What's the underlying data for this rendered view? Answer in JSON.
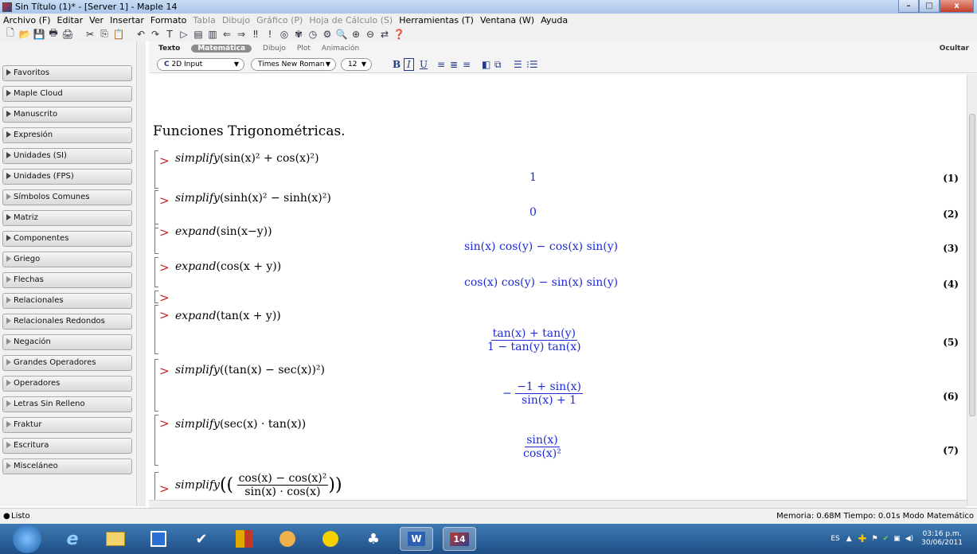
{
  "window": {
    "title": "Sin Título (1)* - [Server 1] - Maple 14",
    "minimize": "–",
    "maximize": "□",
    "close": "x"
  },
  "menu": [
    {
      "label": "Archivo (F)",
      "enabled": true
    },
    {
      "label": "Editar",
      "enabled": true
    },
    {
      "label": "Ver",
      "enabled": true
    },
    {
      "label": "Insertar",
      "enabled": true
    },
    {
      "label": "Formato",
      "enabled": true
    },
    {
      "label": "Tabla",
      "enabled": false
    },
    {
      "label": "Dibujo",
      "enabled": false
    },
    {
      "label": "Gráfico (P)",
      "enabled": false
    },
    {
      "label": "Hoja de Cálculo (S)",
      "enabled": false
    },
    {
      "label": "Herramientas (T)",
      "enabled": true
    },
    {
      "label": "Ventana (W)",
      "enabled": true
    },
    {
      "label": "Ayuda",
      "enabled": true
    }
  ],
  "toolbar_icons": [
    "new-icon",
    "open-icon",
    "save-icon",
    "print-icon",
    "print-preview-icon",
    "cut-icon",
    "copy-icon",
    "paste-icon",
    "undo-icon",
    "redo-icon",
    "text-mode-icon",
    "execute-group-icon",
    "insert-section-icon",
    "outdent-icon",
    "back-icon",
    "forward-icon",
    "execute-all-icon",
    "execute-icon",
    "stop-icon",
    "restart-icon",
    "debug-icon",
    "settings-icon",
    "zoom-100-icon",
    "zoom-in-icon",
    "zoom-out-icon",
    "show-hidden-icon",
    "help-icon"
  ],
  "toolbar_glyphs": [
    "🗋",
    "📂",
    "💾",
    "🖶",
    "🖨",
    "✂",
    "⎘",
    "📋",
    "↶",
    "↷",
    "T",
    "▷",
    "▤",
    "▥",
    "⇐",
    "⇒",
    "‼",
    "!",
    "◎",
    "✾",
    "◷",
    "⚙",
    "🔍",
    "⊕",
    "⊖",
    "⇄",
    "❓"
  ],
  "sidebar": {
    "palettes": [
      {
        "label": "Favoritos",
        "state": "collapsed"
      },
      {
        "label": "Maple Cloud",
        "state": "collapsed"
      },
      {
        "label": "Manuscrito",
        "state": "collapsed"
      },
      {
        "label": "Expresión",
        "state": "collapsed"
      },
      {
        "label": "Unidades (SI)",
        "state": "collapsed"
      },
      {
        "label": "Unidades (FPS)",
        "state": "collapsed"
      },
      {
        "label": "Símbolos Comunes",
        "state": "empty"
      },
      {
        "label": "Matriz",
        "state": "collapsed"
      },
      {
        "label": "Componentes",
        "state": "collapsed"
      },
      {
        "label": "Griego",
        "state": "empty"
      },
      {
        "label": "Flechas",
        "state": "empty"
      },
      {
        "label": "Relacionales",
        "state": "empty"
      },
      {
        "label": "Relacionales Redondos",
        "state": "empty"
      },
      {
        "label": "Negación",
        "state": "empty"
      },
      {
        "label": "Grandes Operadores",
        "state": "empty"
      },
      {
        "label": "Operadores",
        "state": "empty"
      },
      {
        "label": "Letras Sin Relleno",
        "state": "empty"
      },
      {
        "label": "Fraktur",
        "state": "empty"
      },
      {
        "label": "Escritura",
        "state": "empty"
      },
      {
        "label": "Misceláneo",
        "state": "empty"
      }
    ]
  },
  "context": {
    "tabs": [
      {
        "label": "Texto",
        "active": false
      },
      {
        "label": "Matemática",
        "active": true
      },
      {
        "label": "Dibujo",
        "active": false
      },
      {
        "label": "Plot",
        "active": false
      },
      {
        "label": "Animación",
        "active": false
      }
    ],
    "hide_label": "Ocultar",
    "input_mode": "2D Input",
    "input_mode_icon": "C",
    "font": "Times New Roman",
    "size": "12",
    "format_buttons": [
      "B",
      "I",
      "U"
    ],
    "align_glyphs": [
      "≡",
      "≣",
      "≡",
      "◧",
      "⧉",
      "☰",
      "⁝☰"
    ]
  },
  "document": {
    "title": "Funciones Trigonométricas.",
    "prompt": ">",
    "commands": [
      {
        "cmd": "simplify",
        "arg": "sin(x)² + cos(x)²",
        "output": "1",
        "label": "(1)"
      },
      {
        "cmd": "simplify",
        "arg": "sinh(x)² − sinh(x)²",
        "output": "0",
        "label": "(2)"
      },
      {
        "cmd": "expand",
        "arg": "sin(x−y)",
        "output": "sin(x) cos(y) − cos(x) sin(y)",
        "label": "(3)"
      },
      {
        "cmd": "expand",
        "arg": "cos(x + y)",
        "output": "cos(x) cos(y) − sin(x) sin(y)",
        "label": "(4)"
      },
      {
        "cmd": "expand",
        "arg": "tan(x + y)",
        "output_num": "tan(x) + tan(y)",
        "output_den": "1 − tan(y) tan(x)",
        "label": "(5)"
      },
      {
        "cmd": "simplify",
        "arg": "(tan(x) − sec(x))²",
        "output_sign": "−",
        "output_num": "−1 + sin(x)",
        "output_den": "sin(x) + 1",
        "label": "(6)"
      },
      {
        "cmd": "simplify",
        "arg": "sec(x) · tan(x)",
        "output_num": "sin(x)",
        "output_den": "cos(x)²",
        "label": "(7)"
      },
      {
        "cmd": "simplify",
        "arg_num": "cos(x) − cos(x)²",
        "arg_den": "sin(x) · cos(x)"
      }
    ]
  },
  "status": {
    "left": "Listo",
    "right": "Memoria: 0.68M  Tiempo: 0.01s  Modo Matemático"
  },
  "taskbar": {
    "lang": "ES",
    "time": "03:16 p.m.",
    "date": "30/06/2011",
    "maple_badge": "14",
    "word_badge": "W"
  }
}
